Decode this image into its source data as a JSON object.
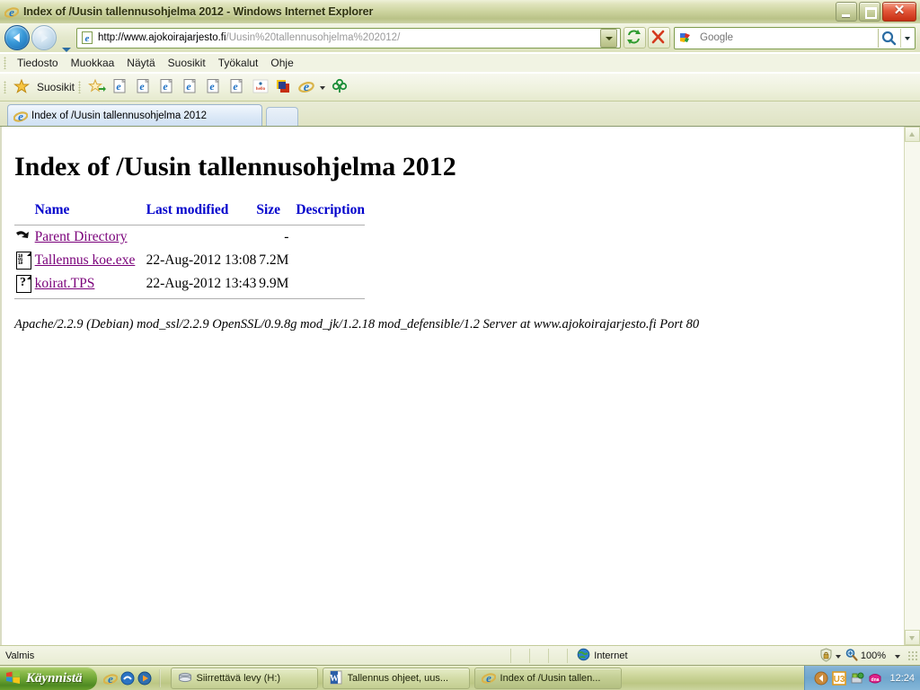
{
  "window": {
    "title": "Index of /Uusin tallennusohjelma 2012 - Windows Internet Explorer",
    "app_icon": "ie-icon",
    "minimize_label": "Pienennä",
    "maximize_label": "Palauta",
    "close_label": "Sulje"
  },
  "nav": {
    "back_label": "Takaisin",
    "forward_label": "Eteenpäin",
    "history_label": "Viimeisimmät sivut",
    "address_icon": "ie-page-icon",
    "address_value": "http://www.ajokoirajarjesto.fi/Uusin%20tallennusohjelma%202012/",
    "address_host": "http://www.ajokoirajarjesto.fi",
    "address_path": "/Uusin%20tallennusohjelma%202012/",
    "address_dropdown_label": "Osoitevalikko",
    "refresh_label": "Päivitä",
    "stop_label": "Pysäytä"
  },
  "search": {
    "provider_icon": "google-icon",
    "placeholder": "Google",
    "value": "",
    "go_label": "Hae",
    "dropdown_label": "Hakuasetukset"
  },
  "menu": {
    "items": [
      {
        "label": "Tiedosto",
        "name": "menu-file"
      },
      {
        "label": "Muokkaa",
        "name": "menu-edit"
      },
      {
        "label": "Näytä",
        "name": "menu-view"
      },
      {
        "label": "Suosikit",
        "name": "menu-favorites"
      },
      {
        "label": "Työkalut",
        "name": "menu-tools"
      },
      {
        "label": "Ohje",
        "name": "menu-help"
      }
    ]
  },
  "favorites_bar": {
    "button_label": "Suosikit",
    "button_icon": "star-icon",
    "items": [
      {
        "icon": "add-to-favorites-icon",
        "name": "favbar-add"
      },
      {
        "icon": "ie-page-icon",
        "name": "favbar-link-1"
      },
      {
        "icon": "ie-page-icon",
        "name": "favbar-link-2"
      },
      {
        "icon": "ie-page-icon",
        "name": "favbar-link-3"
      },
      {
        "icon": "ie-page-icon",
        "name": "favbar-link-4"
      },
      {
        "icon": "ie-page-icon",
        "name": "favbar-link-5"
      },
      {
        "icon": "ie-page-icon",
        "name": "favbar-link-6"
      },
      {
        "icon": "hello-icon",
        "name": "favbar-link-7"
      },
      {
        "icon": "colored-squares-icon",
        "name": "favbar-link-8"
      },
      {
        "icon": "ie-icon",
        "name": "favbar-link-9"
      }
    ]
  },
  "tabs": {
    "active": {
      "title": "Index of /Uusin tallennusohjelma 2012",
      "icon": "ie-icon"
    },
    "new_tab_label": "Uusi välilehti"
  },
  "page": {
    "heading": "Index of /Uusin tallennusohjelma 2012",
    "columns": [
      {
        "label": "Name",
        "name": "column-name"
      },
      {
        "label": "Last modified",
        "name": "column-last-modified"
      },
      {
        "label": "Size",
        "name": "column-size"
      },
      {
        "label": "Description",
        "name": "column-description"
      }
    ],
    "rows": [
      {
        "icon": "parent-directory-icon",
        "name": "Parent Directory",
        "last_modified": "",
        "size": "-",
        "description": ""
      },
      {
        "icon": "binary-file-icon",
        "name": "Tallennus  koe.exe",
        "last_modified": "22-Aug-2012 13:08",
        "size": "7.2M",
        "description": ""
      },
      {
        "icon": "unknown-file-icon",
        "name": "koirat.TPS",
        "last_modified": "22-Aug-2012 13:43",
        "size": "9.9M",
        "description": ""
      }
    ],
    "server_signature": "Apache/2.2.9 (Debian) mod_ssl/2.2.9 OpenSSL/0.9.8g mod_jk/1.2.18 mod_defensible/1.2 Server at www.ajokoirajarjesto.fi Port 80",
    "link_color": "#7a007a",
    "header_link_color": "#0000cc"
  },
  "scrollbar": {
    "up_label": "Vieritä ylös",
    "down_label": "Vieritä alas"
  },
  "statusbar": {
    "status_text": "Valmis",
    "zone_icon": "globe-icon",
    "zone_label": "Internet",
    "protected_mode_icon": "shield-lock-icon",
    "zoom_icon": "magnifier-icon",
    "zoom_level": "100%"
  },
  "taskbar": {
    "start_label": "Käynnistä",
    "start_icon": "windows-logo-icon",
    "quick_launch": [
      {
        "icon": "ie-icon",
        "name": "quicklaunch-ie"
      },
      {
        "icon": "blue-app-icon",
        "name": "quicklaunch-app-2"
      },
      {
        "icon": "media-player-icon",
        "name": "quicklaunch-media-player"
      }
    ],
    "items": [
      {
        "icon": "removable-drive-icon",
        "label": "Siirrettävä levy (H:)",
        "name": "taskbar-item-drive"
      },
      {
        "icon": "word-icon",
        "label": "Tallennus ohjeet, uus...",
        "name": "taskbar-item-word"
      },
      {
        "icon": "ie-icon",
        "label": "Index of /Uusin tallen...",
        "name": "taskbar-item-ie"
      }
    ],
    "tray": [
      {
        "icon": "show-hidden-icons-icon",
        "name": "tray-expand"
      },
      {
        "icon": "u3-icon",
        "name": "tray-u3"
      },
      {
        "icon": "safely-remove-icon",
        "name": "tray-safely-remove"
      },
      {
        "icon": "dna-icon",
        "name": "tray-dna"
      }
    ],
    "clock": "12:24"
  }
}
